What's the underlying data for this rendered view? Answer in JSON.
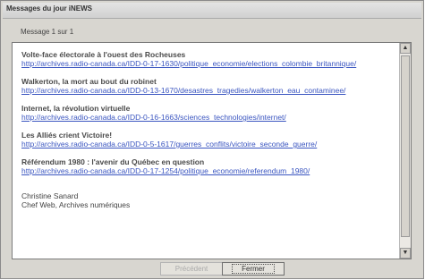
{
  "window": {
    "title": "Messages du jour iNEWS"
  },
  "header": {
    "message_count": "Message 1 sur 1"
  },
  "items": [
    {
      "title": "Volte-face électorale à l'ouest des Rocheuses",
      "link": "http://archives.radio-canada.ca/IDD-0-17-1630/politique_economie/elections_colombie_britannique/"
    },
    {
      "title": "Walkerton, la mort au bout du robinet",
      "link": "http://archives.radio-canada.ca/IDD-0-13-1670/desastres_tragedies/walkerton_eau_contaminee/"
    },
    {
      "title": "Internet, la révolution virtuelle",
      "link": "http://archives.radio-canada.ca/IDD-0-16-1663/sciences_technologies/internet/"
    },
    {
      "title": "Les Alliés crient Victoire!",
      "link": "http://archives.radio-canada.ca/IDD-0-5-1617/guerres_conflits/victoire_seconde_guerre/"
    },
    {
      "title": "Référendum 1980 : l'avenir du Québec en question",
      "link": "http://archives.radio-canada.ca/IDD-0-17-1254/politique_economie/referendum_1980/"
    }
  ],
  "signature": {
    "name": "Christine Sanard",
    "role": "Chef Web, Archives numériques"
  },
  "buttons": {
    "previous": "Précédent",
    "close": "Fermer"
  }
}
